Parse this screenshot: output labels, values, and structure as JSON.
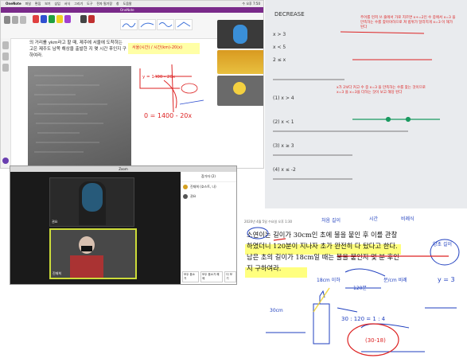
{
  "onenote": {
    "menu_items": [
      "OneNote",
      "파일",
      "편집",
      "보기",
      "삽입",
      "서식",
      "그리기",
      "도구",
      "전자 필기장",
      "창",
      "도움말"
    ],
    "window_title": "OneNote",
    "status_time": "수 오후 7:50",
    "problem_text_line1": "의 거리를 ykm라고 할 때, 제주에 서울에 도착하는",
    "problem_text_line2": "고은 제주도 남쪽 해상을 출발한 지 몇 시간 후인지 구",
    "problem_text_line3": "하여라.",
    "annotation_time": "서울(시간) / 시간(km)-20(x)",
    "annotation_formula": "y = 1400 - 20x",
    "annotation_result": "0 = 1400 - 20x"
  },
  "whiteboard": {
    "top_label": "DECREASE",
    "note_block_1": "주어를 먼저 쓰 줄에서 가로 지르면 x+=2인 수 중에서 x=3 을 만족하는 수를 찾아야하므로 쳐 범위가 달라지게 x=3 이 해가 된다",
    "note_block_2": "x가 2보다 커고 수 중 x=3 을 만족하는 수를 찾는 것이므로 x=3 을 x=3을 더하는 것이 보고 해당 된다",
    "equations": [
      "x > 3",
      "x < 5",
      "2 ≤ x",
      "(1) x > 4",
      "(2) x < 1",
      "(3) x ≥ 3",
      "(4) x ≤ -2"
    ]
  },
  "zoom": {
    "window_title": "Zoom",
    "participants_header": "참가자 (2)",
    "participants": [
      {
        "name": "진재희 (호스트, 나)"
      },
      {
        "name": "권요"
      }
    ],
    "mute_all_label": "모두 음소거",
    "unmute_all_label": "모두 음소거 해제",
    "more_label": "더 보기",
    "tile_names": [
      "권요",
      "진재희"
    ]
  },
  "problem": {
    "header": "2020년 4월 5일 수요일  오후 1:30",
    "line1": "소연이는 길이가 30cm인 초에 불을 붙인 후 이를 관찰",
    "line2": "하였더니 120분이 지나자 초가 완전히 다 탔다고 한다.",
    "line3": "남은 초의 길이가 18cm일 때는 불을 붙인지 몇 분 후인",
    "line4": "지 구하여라.",
    "hand_notes": [
      "처음 길이",
      "시간",
      "비례식",
      "양초 길이",
      "120분",
      "30cm",
      "30 : 120 = 1 : 4",
      "y = 3",
      "18cm 이하",
      "분/cm 비례",
      "(30-18)"
    ]
  }
}
